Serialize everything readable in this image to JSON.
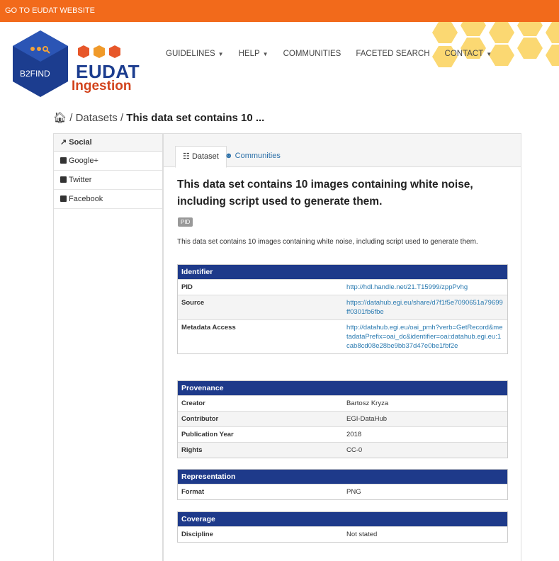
{
  "topbar": {
    "link_text": "GO TO EUDAT WEBSITE"
  },
  "logo": {
    "b2find_text": "B2FIND",
    "eudat_text": "EUDAT",
    "ingestion_text": "Ingestion"
  },
  "nav": {
    "items": [
      {
        "label": "GUIDELINES",
        "dropdown": true
      },
      {
        "label": "HELP",
        "dropdown": true
      },
      {
        "label": "COMMUNITIES",
        "dropdown": false
      },
      {
        "label": "FACETED SEARCH",
        "dropdown": false
      },
      {
        "label": "CONTACT",
        "dropdown": true
      }
    ]
  },
  "breadcrumb": {
    "datasets": "Datasets",
    "current": "This data set contains 10 ..."
  },
  "sidebar": {
    "heading": "Social",
    "items": [
      "Google+",
      "Twitter",
      "Facebook"
    ]
  },
  "tabs": [
    {
      "label": "Dataset"
    },
    {
      "label": "Communities"
    }
  ],
  "dataset": {
    "title": "This data set contains 10 images containing white noise, including script used to generate them.",
    "pid_badge": "PID",
    "description": "This data set contains 10 images containing white noise, including script used to generate them."
  },
  "panels": {
    "identifier": {
      "title": "Identifier",
      "rows": [
        {
          "key": "PID",
          "value": "http://hdl.handle.net/21.T15999/zppPvhg"
        },
        {
          "key": "Source",
          "value": "https://datahub.egi.eu/share/d7f1f5e7090651a79699ff0301fb6fbe"
        },
        {
          "key": "Metadata Access",
          "value": "http://datahub.egi.eu/oai_pmh?verb=GetRecord&metadataPrefix=oai_dc&identifier=oai:datahub.egi.eu:1cab8cd08e28be9bb37d47e0be1fbf2e"
        }
      ]
    },
    "provenance": {
      "title": "Provenance",
      "rows": [
        {
          "key": "Creator",
          "value": "Bartosz Kryza"
        },
        {
          "key": "Contributor",
          "value": "EGI-DataHub"
        },
        {
          "key": "Publication Year",
          "value": "2018"
        },
        {
          "key": "Rights",
          "value": "CC-0"
        }
      ]
    },
    "representation": {
      "title": "Representation",
      "rows": [
        {
          "key": "Format",
          "value": "PNG"
        }
      ]
    },
    "coverage": {
      "title": "Coverage",
      "rows": [
        {
          "key": "Discipline",
          "value": "Not stated"
        }
      ]
    }
  },
  "colors": {
    "topbar": "#f26a1b",
    "panel_header": "#1e3a8a",
    "link": "#2a7ab0"
  }
}
